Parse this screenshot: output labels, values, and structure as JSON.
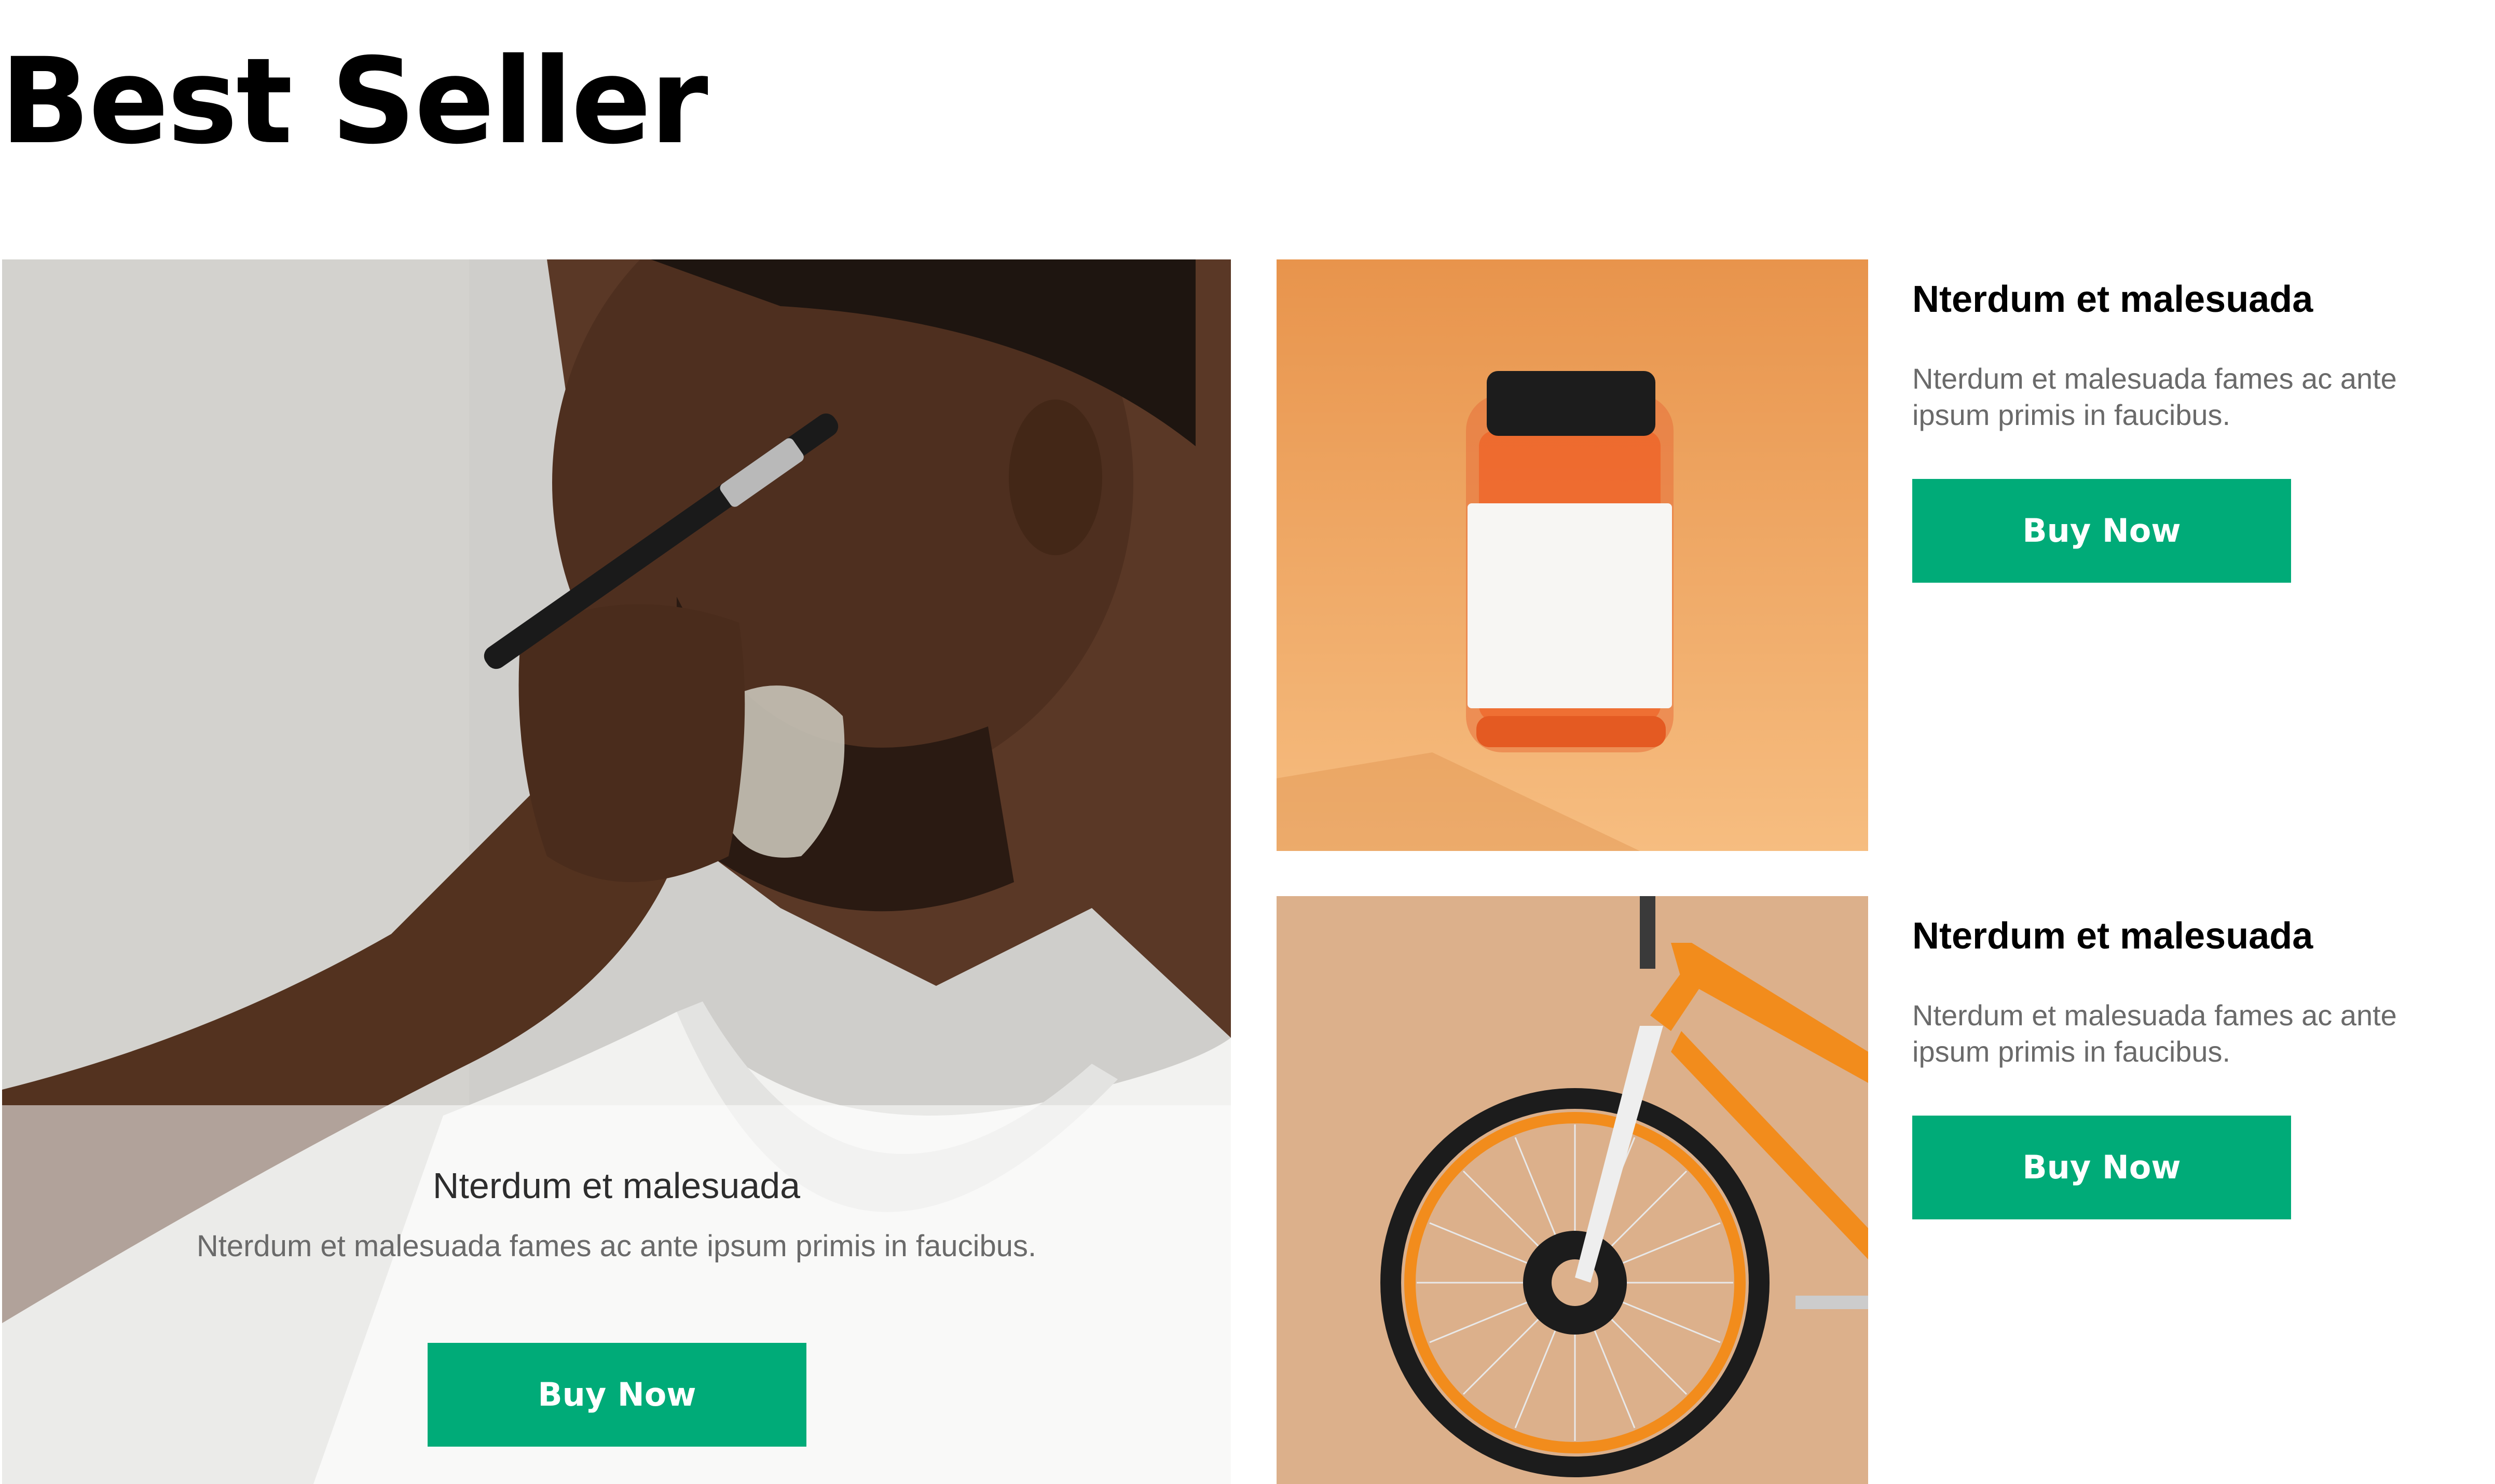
{
  "section": {
    "title": "Best Seller"
  },
  "featured": {
    "title": "Nterdum et malesuada",
    "description": "Nterdum et malesuada fames ac ante ipsum primis in faucibus.",
    "button_label": "Buy Now"
  },
  "products": [
    {
      "title": "Nterdum et malesuada",
      "description": "Nterdum et malesuada fames ac ante ipsum primis in faucibus.",
      "button_label": "Buy Now"
    },
    {
      "title": "Nterdum et malesuada",
      "description": "Nterdum et malesuada fames ac ante ipsum primis in faucibus.",
      "button_label": "Buy Now"
    }
  ],
  "colors": {
    "accent": "#00ab78",
    "heading": "#000000",
    "body_text": "#6a6a6a"
  }
}
